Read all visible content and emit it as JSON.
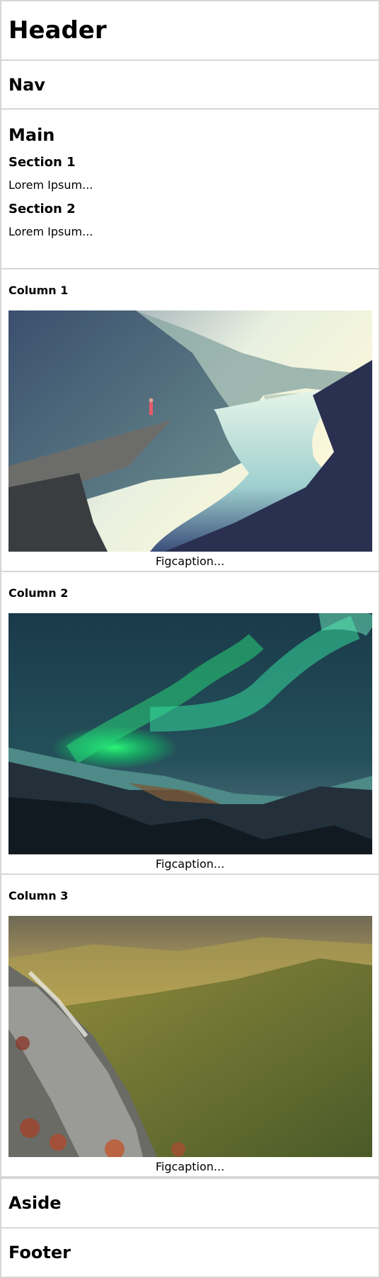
{
  "header": {
    "title": "Header"
  },
  "nav": {
    "title": "Nav"
  },
  "main": {
    "title": "Main",
    "sections": [
      {
        "title": "Section 1",
        "body": "Lorem Ipsum..."
      },
      {
        "title": "Section 2",
        "body": "Lorem Ipsum..."
      }
    ]
  },
  "columns": [
    {
      "title": "Column 1",
      "caption": "Figcaption...",
      "image": "fjord-cliff-photo"
    },
    {
      "title": "Column 2",
      "caption": "Figcaption...",
      "image": "aurora-photo"
    },
    {
      "title": "Column 3",
      "caption": "Figcaption...",
      "image": "forest-valley-photo"
    }
  ],
  "aside": {
    "title": "Aside"
  },
  "footer": {
    "title": "Footer"
  }
}
